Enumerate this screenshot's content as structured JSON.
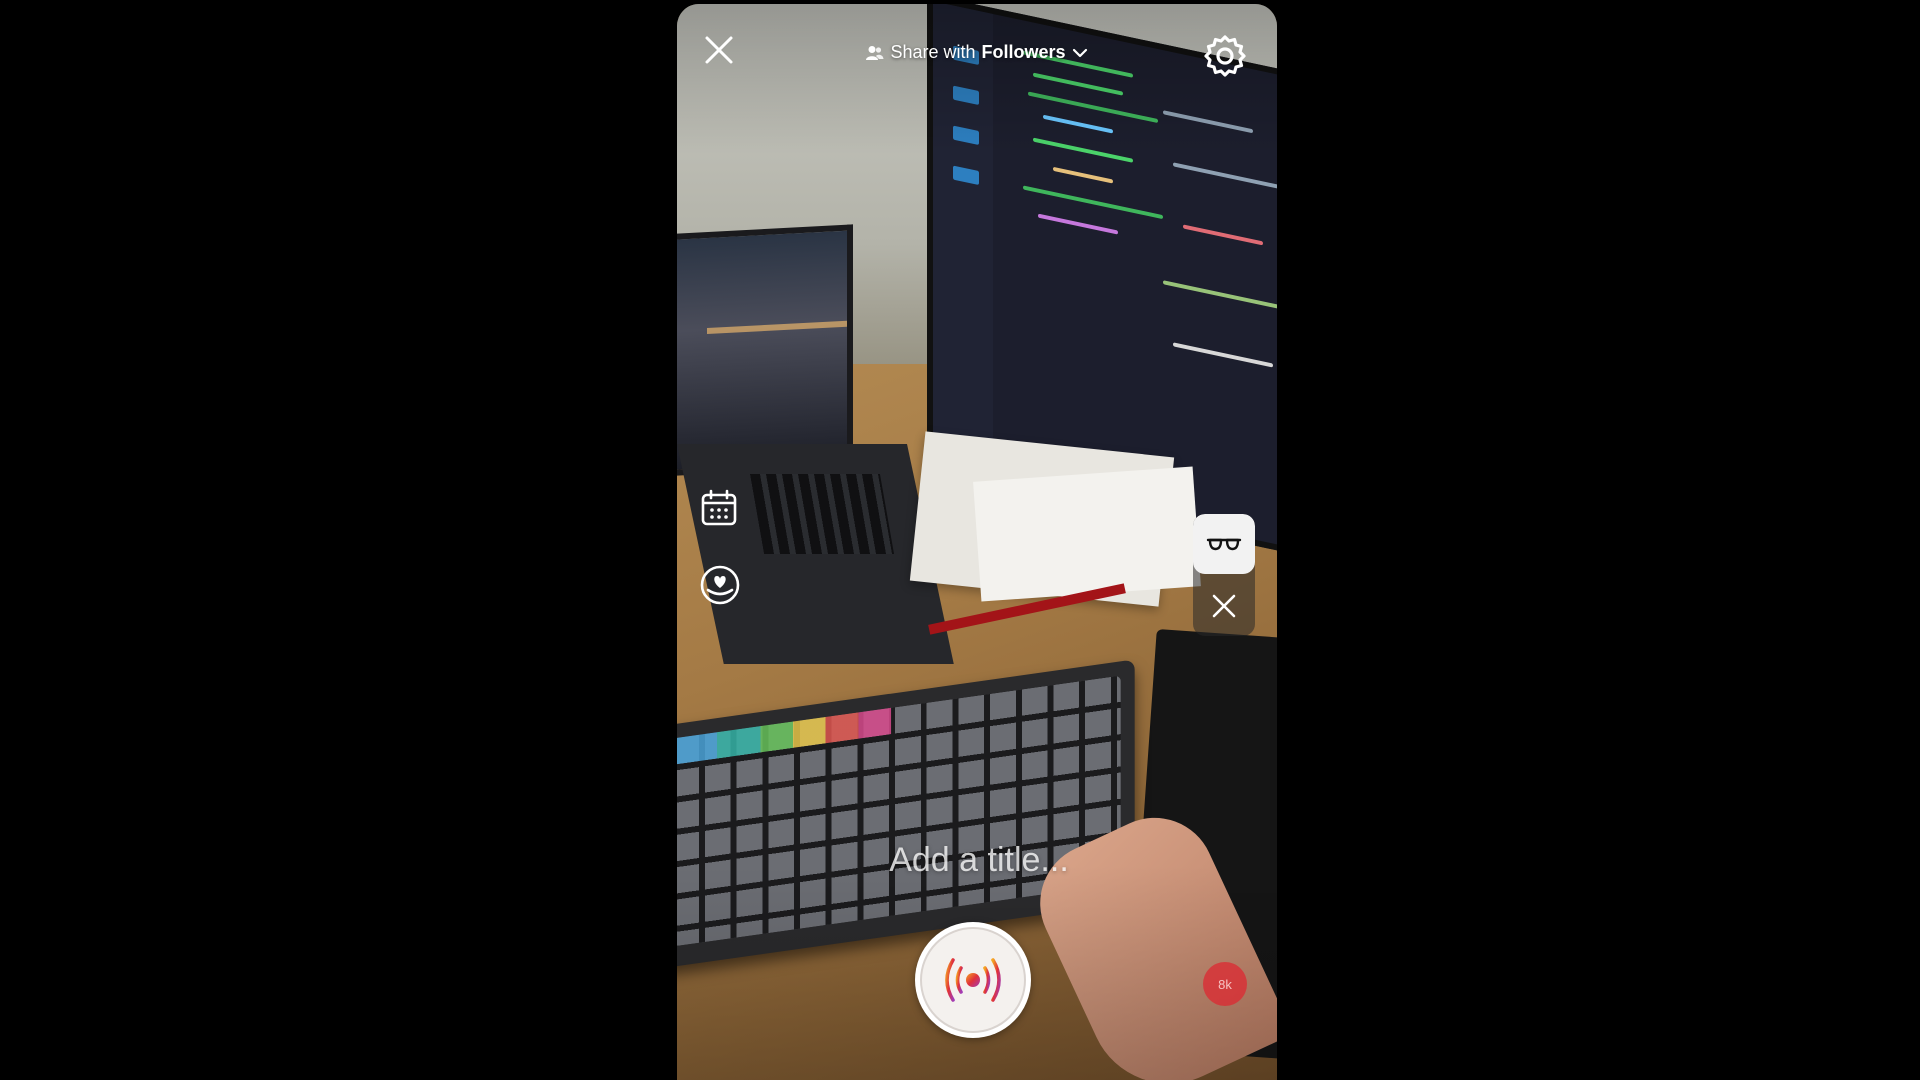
{
  "header": {
    "close_icon": "close-icon",
    "share_prefix": "Share with",
    "share_audience": "Followers",
    "audience_icon": "people-icon",
    "dropdown_icon": "chevron-down-icon",
    "settings_icon": "gear-icon"
  },
  "side_tools": {
    "schedule_icon": "calendar-icon",
    "fundraiser_icon": "heart-icon"
  },
  "effects": {
    "glasses_icon": "glasses-icon",
    "remove_icon": "close-icon"
  },
  "title_field": {
    "placeholder": "Add a title..."
  },
  "live_button": {
    "icon": "broadcast-icon"
  },
  "viewer_badge": {
    "text": "8k"
  },
  "colors": {
    "accent_red": "#e0303a",
    "accent_orange": "#f08a24",
    "accent_purple": "#a23cb5"
  }
}
